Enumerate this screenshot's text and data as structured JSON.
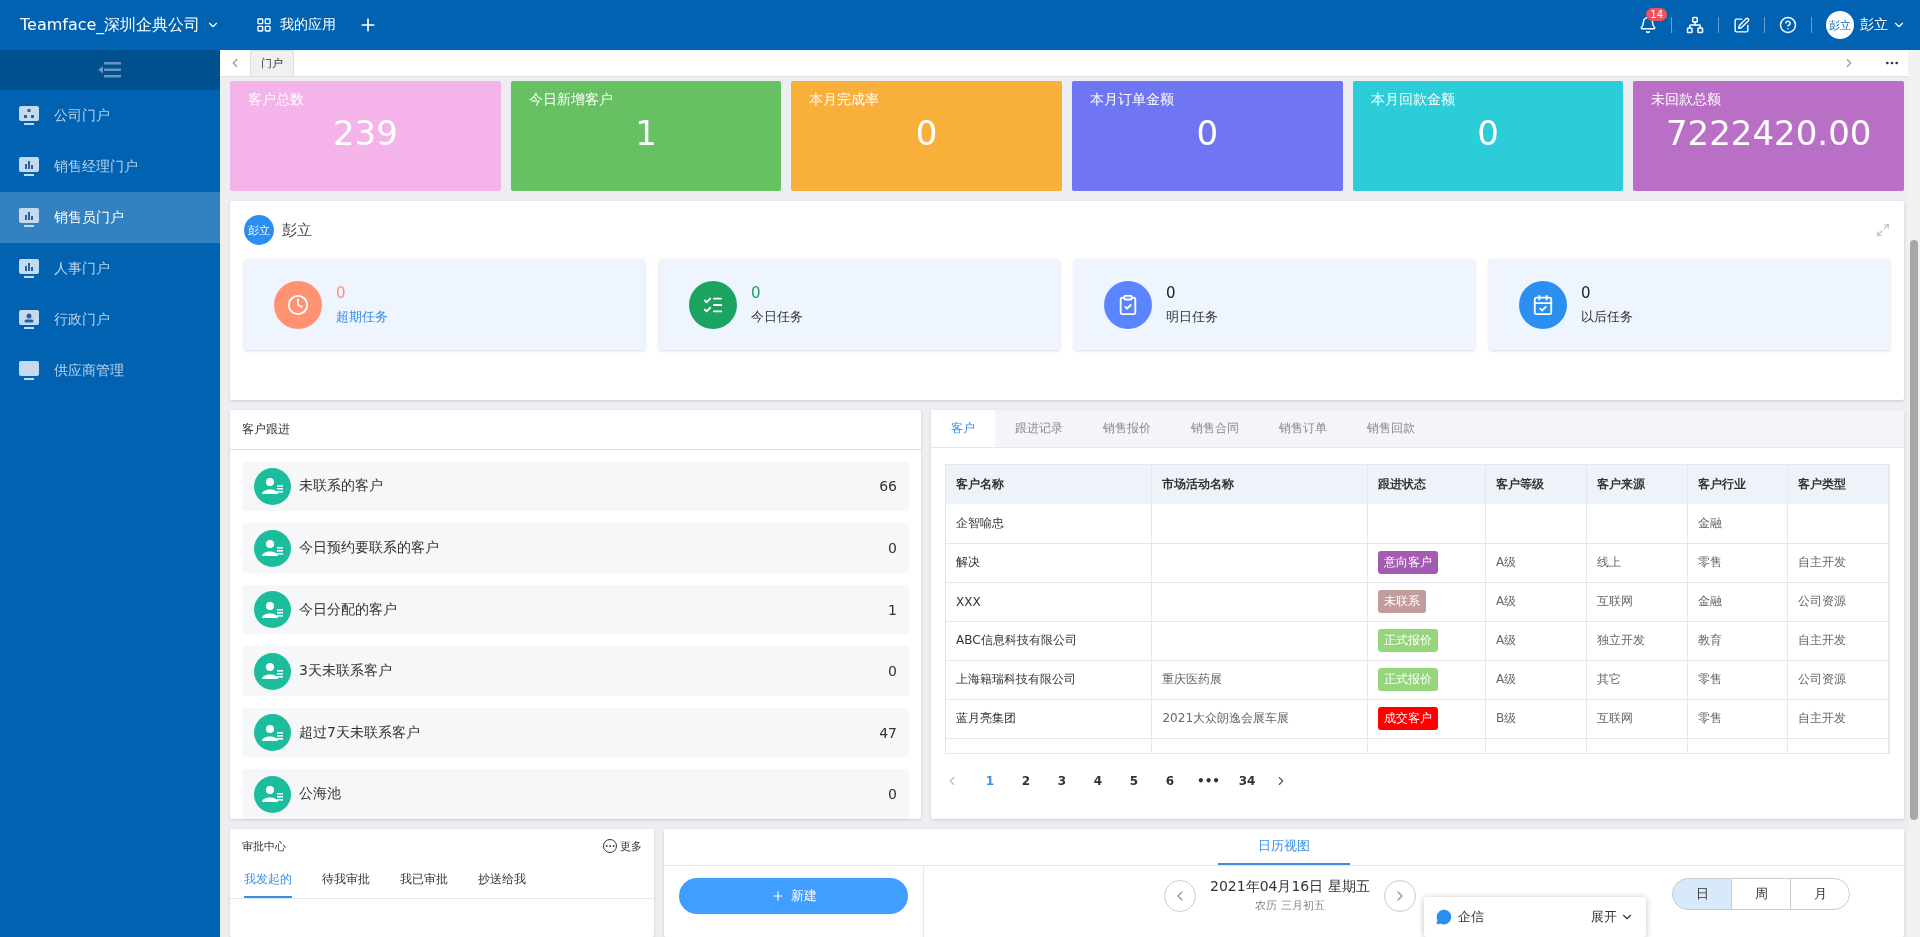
{
  "topbar": {
    "company": "Teamface_深圳企典公司",
    "apps_label": "我的应用",
    "notification_count": "14",
    "avatar_text": "彭立",
    "user_name": "彭立"
  },
  "sidebar": {
    "items": [
      {
        "label": "公司门户",
        "selected": false
      },
      {
        "label": "销售经理门户",
        "selected": false
      },
      {
        "label": "销售员门户",
        "selected": true
      },
      {
        "label": "人事门户",
        "selected": false
      },
      {
        "label": "行政门户",
        "selected": false
      },
      {
        "label": "供应商管理",
        "selected": false
      }
    ]
  },
  "page_tabs": [
    {
      "label": "门户",
      "selected": true
    }
  ],
  "stats": [
    {
      "label": "客户总数",
      "value": "239",
      "color": "#f4b3e9"
    },
    {
      "label": "今日新增客户",
      "value": "1",
      "color": "#67c162"
    },
    {
      "label": "本月完成率",
      "value": "0",
      "color": "#f8b03a"
    },
    {
      "label": "本月订单金额",
      "value": "0",
      "color": "#7075f4"
    },
    {
      "label": "本月回款金额",
      "value": "0",
      "color": "#2ccdd9"
    },
    {
      "label": "未回款总额",
      "value": "7222420.00",
      "color": "#ba6fc6"
    }
  ],
  "user_panel": {
    "avatar_text": "彭立",
    "name": "彭立",
    "tasks": [
      {
        "count": "0",
        "label": "超期任务",
        "color": "#ff9371",
        "highlight": true,
        "link": true
      },
      {
        "count": "0",
        "label": "今日任务",
        "color": "#1ba360",
        "highlight": true,
        "link": false
      },
      {
        "count": "0",
        "label": "明日任务",
        "color": "#5b85ff",
        "highlight": false,
        "link": false
      },
      {
        "count": "0",
        "label": "以后任务",
        "color": "#2b8ff0",
        "highlight": false,
        "link": false
      }
    ]
  },
  "followup": {
    "title": "客户跟进",
    "items": [
      {
        "label": "未联系的客户",
        "count": "66"
      },
      {
        "label": "今日预约要联系的客户",
        "count": "0"
      },
      {
        "label": "今日分配的客户",
        "count": "1"
      },
      {
        "label": "3天未联系客户",
        "count": "0"
      },
      {
        "label": "超过7天未联系客户",
        "count": "47"
      },
      {
        "label": "公海池",
        "count": "0"
      }
    ]
  },
  "records": {
    "tabs": [
      {
        "label": "客户",
        "selected": true
      },
      {
        "label": "跟进记录",
        "selected": false
      },
      {
        "label": "销售报价",
        "selected": false
      },
      {
        "label": "销售合同",
        "selected": false
      },
      {
        "label": "销售订单",
        "selected": false
      },
      {
        "label": "销售回款",
        "selected": false
      }
    ],
    "columns": [
      "客户名称",
      "市场活动名称",
      "跟进状态",
      "客户等级",
      "客户来源",
      "客户行业",
      "客户类型"
    ],
    "rows": [
      {
        "name": "企智喻忠",
        "industry": "金融"
      },
      {
        "name": "解决",
        "status": {
          "label": "意向客户",
          "color": "#a35cb2"
        },
        "level": "A级",
        "source": "线上",
        "industry": "零售",
        "type": "自主开发"
      },
      {
        "name": "XXX",
        "status": {
          "label": "未联系",
          "color": "#c39c9c"
        },
        "level": "A级",
        "source": "互联网",
        "industry": "金融",
        "type": "公司资源"
      },
      {
        "name": "ABC信息科技有限公司",
        "status": {
          "label": "正式报价",
          "color": "#95d67c"
        },
        "level": "A级",
        "source": "独立开发",
        "industry": "教育",
        "type": "自主开发"
      },
      {
        "name": "上海籍瑞科技有限公司",
        "campaign": "重庆医药展",
        "status": {
          "label": "正式报价",
          "color": "#95d67c"
        },
        "level": "A级",
        "source": "其它",
        "industry": "零售",
        "type": "公司资源"
      },
      {
        "name": "蓝月亮集团",
        "campaign": "2021大众朗逸会展车展",
        "status": {
          "label": "成交客户",
          "color": "#ff0000"
        },
        "level": "B级",
        "source": "互联网",
        "industry": "零售",
        "type": "自主开发"
      }
    ],
    "pages": [
      {
        "label": "1",
        "selected": true
      },
      {
        "label": "2",
        "selected": false
      },
      {
        "label": "3",
        "selected": false
      },
      {
        "label": "4",
        "selected": false
      },
      {
        "label": "5",
        "selected": false
      },
      {
        "label": "6",
        "selected": false
      },
      {
        "label": "•••",
        "selected": false
      },
      {
        "label": "34",
        "selected": false
      }
    ]
  },
  "approvals": {
    "title": "审批中心",
    "more": "更多",
    "tabs": [
      {
        "label": "我发起的",
        "selected": true
      },
      {
        "label": "待我审批",
        "selected": false
      },
      {
        "label": "我已审批",
        "selected": false
      },
      {
        "label": "抄送给我",
        "selected": false
      }
    ]
  },
  "calendar": {
    "tabs": [
      {
        "label": "日历视图",
        "selected": true
      }
    ],
    "new_button": "新建",
    "date": "2021年04月16日 星期五",
    "lunar": "农历 三月初五",
    "views": [
      {
        "label": "日",
        "selected": true
      },
      {
        "label": "周",
        "selected": false
      },
      {
        "label": "月",
        "selected": false
      }
    ]
  },
  "chat": {
    "title": "企信",
    "expand": "展开"
  }
}
